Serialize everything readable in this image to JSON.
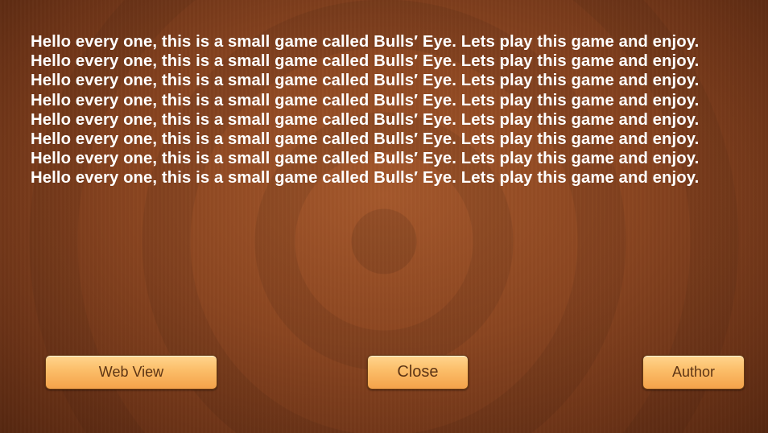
{
  "about": {
    "text": "Hello every one, this is a small game called Bulls′ Eye.  Lets play this game and enjoy. Hello every one, this is a small game called Bulls′ Eye.  Lets play this game and enjoy. Hello every one, this is a small game called Bulls′ Eye.  Lets play this game and enjoy. Hello every one, this is a small game called Bulls′ Eye.  Lets play this game and enjoy. Hello every one, this is a small game called Bulls′ Eye.  Lets play this game and enjoy. Hello every one, this is a small game called Bulls′ Eye.  Lets play this game and enjoy. Hello every one, this is a small game called Bulls′ Eye.  Lets play this game and enjoy. Hello every one, this is a small game called Bulls′ Eye.  Lets play this game and enjoy."
  },
  "buttons": {
    "web_view": "Web View",
    "close": "Close",
    "author": "Author"
  },
  "colors": {
    "background": "#8a4520",
    "text": "#ffffff",
    "button_top": "#ffd58e",
    "button_bottom": "#f4a24a",
    "button_text": "#5d3515"
  }
}
